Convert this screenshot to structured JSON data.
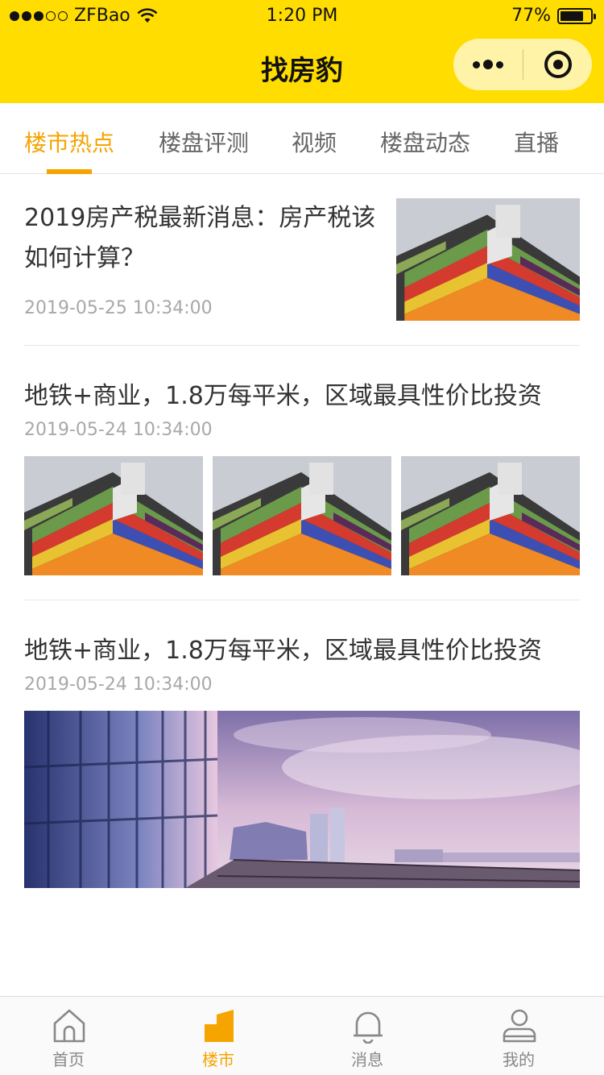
{
  "status_bar": {
    "carrier": "ZFBao",
    "time": "1:20 PM",
    "battery": "77%",
    "battery_level": 0.77
  },
  "nav": {
    "title": "找房豹",
    "menu_icon": "more-dots-icon",
    "close_icon": "target-icon"
  },
  "tabs": [
    {
      "label": "楼市热点",
      "active": true
    },
    {
      "label": "楼盘评测",
      "active": false
    },
    {
      "label": "视频",
      "active": false
    },
    {
      "label": "楼盘动态",
      "active": false
    },
    {
      "label": "直播",
      "active": false
    }
  ],
  "articles": [
    {
      "title": "2019房产税最新消息：房产税该如何计算？",
      "date": "2019-05-25 10:34:00",
      "image": "colorful-building"
    },
    {
      "title": "地铁+商业，1.8万每平米，区域最具性价比投资",
      "date": "2019-05-24 10:34:00",
      "images": [
        "colorful-building",
        "colorful-building",
        "colorful-building"
      ]
    },
    {
      "title": "地铁+商业，1.8万每平米，区域最具性价比投资",
      "date": "2019-05-24 10:34:00",
      "image": "city-skyline-terrace"
    }
  ],
  "tabbar": [
    {
      "label": "首页",
      "icon": "home-icon",
      "active": false
    },
    {
      "label": "楼市",
      "icon": "building-icon",
      "active": true
    },
    {
      "label": "消息",
      "icon": "bell-icon",
      "active": false
    },
    {
      "label": "我的",
      "icon": "user-icon",
      "active": false
    }
  ],
  "colors": {
    "brand_yellow": "#FFDD00",
    "accent_orange": "#F5A400"
  }
}
